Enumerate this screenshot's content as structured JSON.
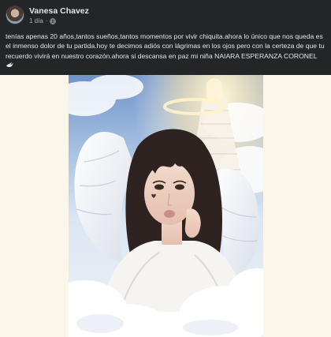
{
  "post": {
    "author": "Vanesa Chavez",
    "time": "1 día",
    "separator": "·",
    "privacy_icon": "globe-icon",
    "text": "tenías apenas 20 años,tantos sueños,tantos momentos por vivir chiquita.ahora lo único que nos queda es el inmenso dolor de tu partida.hoy te decimos adiós con lágrimas en los ojos pero con la certeza de que tu recuerdo vivirá en nuestro corazón.ahora si descansa en paz mi niña NAIARA ESPERANZA CORONEL",
    "emoji_icon": "dove-icon"
  },
  "image": {
    "icon": "angel-memorial-image"
  },
  "colors": {
    "post_background": "#242526",
    "text": "#e4e6eb",
    "secondary_text": "#b0b3b8",
    "page_background": "#fbf6ea"
  }
}
